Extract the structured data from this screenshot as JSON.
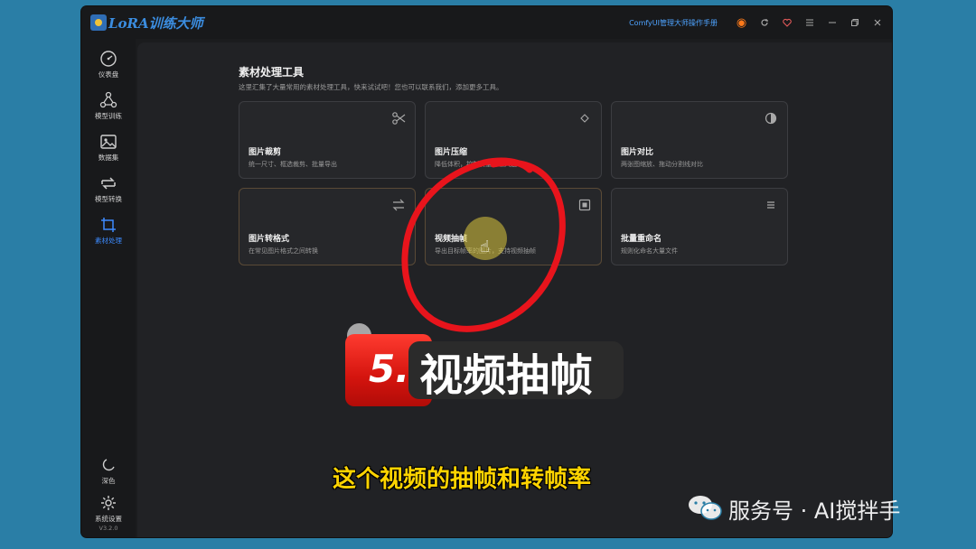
{
  "app": {
    "logo_text": "LoRA训练大师",
    "manual_link": "ComfyUI管理大师操作手册"
  },
  "sidebar": {
    "items": [
      {
        "label": "仪表盘",
        "icon": "gauge-icon"
      },
      {
        "label": "模型训练",
        "icon": "nodes-icon"
      },
      {
        "label": "数据集",
        "icon": "images-icon"
      },
      {
        "label": "模型转换",
        "icon": "convert-icon"
      },
      {
        "label": "素材处理",
        "icon": "crop-icon",
        "active": true
      }
    ],
    "bottom": [
      {
        "label": "深色",
        "icon": "moon-icon"
      },
      {
        "label": "系统设置",
        "icon": "gear-icon"
      }
    ],
    "version": "V3.2.0"
  },
  "page": {
    "title": "素材处理工具",
    "description": "这里汇集了大量常用的素材处理工具，快来试试吧！您也可以联系我们，添加更多工具。"
  },
  "tools": [
    {
      "title": "图片裁剪",
      "desc": "统一尺寸、框选裁剪、批量导出",
      "icon": "scissors-icon"
    },
    {
      "title": "图片压缩",
      "desc": "降低体积，控制质量与最大边",
      "icon": "diamond-icon"
    },
    {
      "title": "图片对比",
      "desc": "两张图缩放、拖动分割线对比",
      "icon": "contrast-icon"
    },
    {
      "title": "图片转格式",
      "desc": "在常见图片格式之间转换",
      "icon": "swap-icon"
    },
    {
      "title": "视频抽帧",
      "desc": "导出目标帧率的图片，支持视频抽帧",
      "icon": "frame-icon"
    },
    {
      "title": "批量重命名",
      "desc": "规则化命名大量文件",
      "icon": "list-icon"
    }
  ],
  "overlay": {
    "banner_number": "5.",
    "banner_text": "视频抽帧",
    "subtitle": "这个视频的抽帧和转帧率",
    "watermark": "服务号 · AI搅拌手"
  },
  "colors": {
    "accent": "#3d8bff",
    "annotation_red": "#e8141c",
    "subtitle_yellow": "#ffd400"
  }
}
